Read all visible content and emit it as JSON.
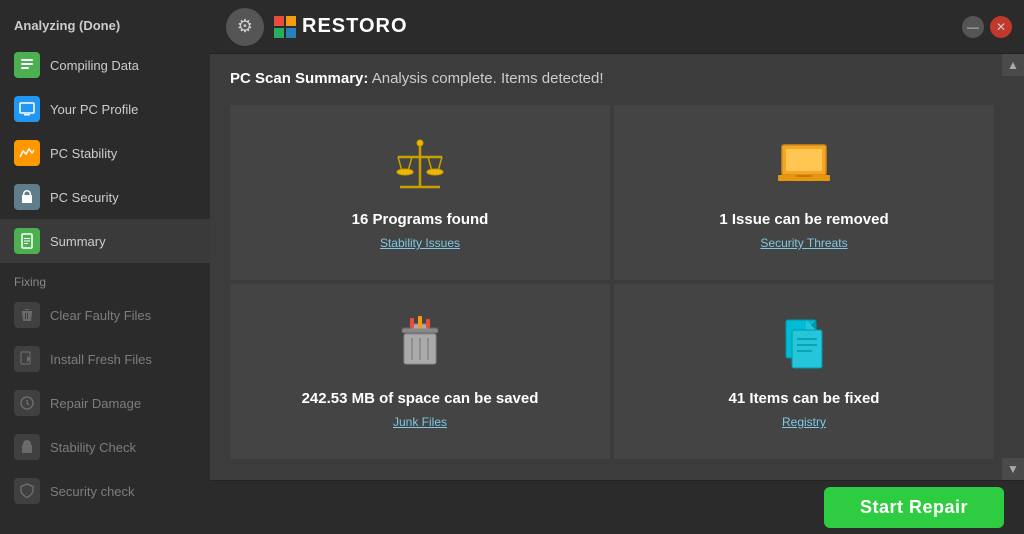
{
  "sidebar": {
    "analyzing_label": "Analyzing (Done)",
    "items_analyzing": [
      {
        "id": "compiling-data",
        "label": "Compiling Data",
        "icon": "📋",
        "icon_class": "icon-green",
        "active": false
      },
      {
        "id": "your-pc-profile",
        "label": "Your PC Profile",
        "icon": "💻",
        "icon_class": "icon-blue",
        "active": false
      },
      {
        "id": "pc-stability",
        "label": "PC Stability",
        "icon": "📊",
        "icon_class": "icon-orange",
        "active": false
      },
      {
        "id": "pc-security",
        "label": "PC Security",
        "icon": "🔒",
        "icon_class": "icon-lock",
        "active": false
      },
      {
        "id": "summary",
        "label": "Summary",
        "icon": "📄",
        "icon_class": "icon-doc",
        "active": true
      }
    ],
    "fixing_label": "Fixing",
    "items_fixing": [
      {
        "id": "clear-faulty-files",
        "label": "Clear Faulty Files",
        "icon": "🗑",
        "icon_class": "icon-grey",
        "disabled": true
      },
      {
        "id": "install-fresh-files",
        "label": "Install Fresh Files",
        "icon": "📥",
        "icon_class": "icon-grey",
        "disabled": true
      },
      {
        "id": "repair-damage",
        "label": "Repair Damage",
        "icon": "⚙️",
        "icon_class": "icon-grey",
        "disabled": true
      },
      {
        "id": "stability-check",
        "label": "Stability Check",
        "icon": "🔧",
        "icon_class": "icon-grey",
        "disabled": true
      },
      {
        "id": "security-check",
        "label": "Security check",
        "icon": "🔐",
        "icon_class": "icon-grey",
        "disabled": true
      }
    ]
  },
  "header": {
    "gear_label": "⚙",
    "logo_text": "RESTORO",
    "min_btn": "—",
    "close_btn": "✕"
  },
  "main": {
    "scan_summary_prefix": "PC Scan Summary:",
    "scan_summary_suffix": "Analysis complete. Items detected!",
    "grid": [
      {
        "id": "programs-found",
        "value": "16 Programs found",
        "sublabel": "Stability Issues",
        "icon_type": "scales"
      },
      {
        "id": "issue-removed",
        "value": "1 Issue can be removed",
        "sublabel": "Security Threats",
        "icon_type": "laptop"
      },
      {
        "id": "space-saved",
        "value": "242.53 MB of space can be saved",
        "sublabel": "Junk Files",
        "icon_type": "trash"
      },
      {
        "id": "items-fixed",
        "value": "41 Items can be fixed",
        "sublabel": "Registry",
        "icon_type": "registry"
      }
    ],
    "start_repair_label": "Start Repair"
  }
}
